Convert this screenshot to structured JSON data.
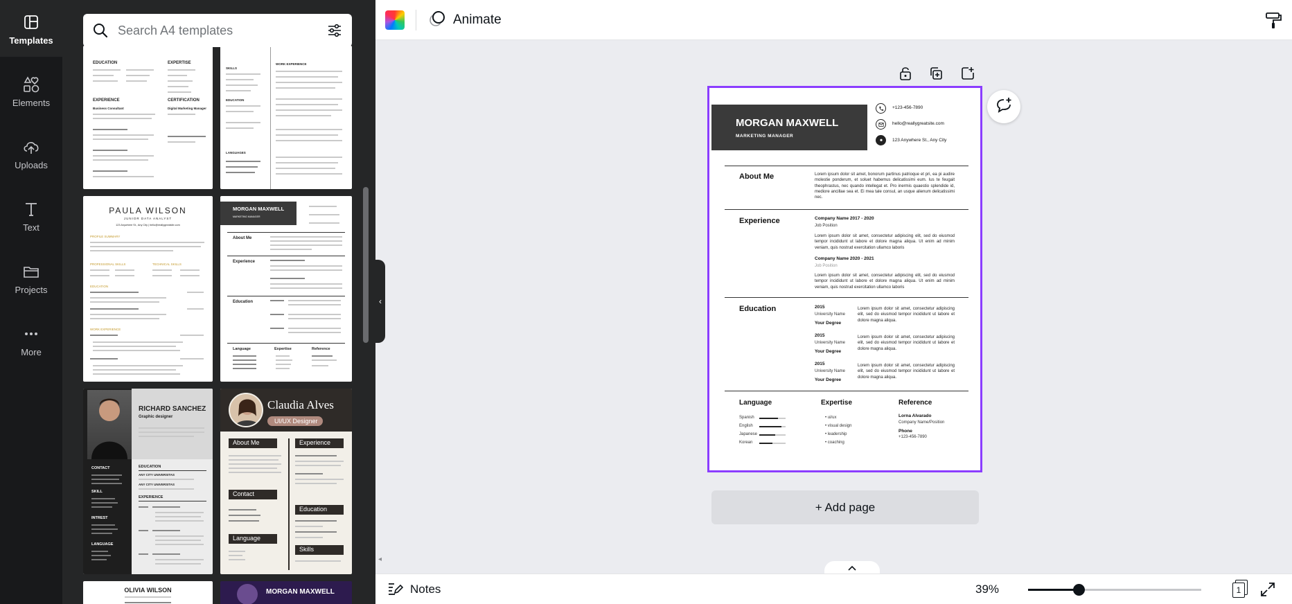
{
  "rail": [
    {
      "label": "Templates",
      "icon": "templates-icon",
      "active": true
    },
    {
      "label": "Elements",
      "icon": "elements-icon"
    },
    {
      "label": "Uploads",
      "icon": "uploads-icon"
    },
    {
      "label": "Text",
      "icon": "text-icon"
    },
    {
      "label": "Projects",
      "icon": "projects-icon"
    },
    {
      "label": "More",
      "icon": "more-icon"
    }
  ],
  "search": {
    "placeholder": "Search A4 templates"
  },
  "thumbnails": {
    "t1": {
      "h1": "EDUCATION",
      "h2": "EXPERTISE",
      "h3": "EXPERIENCE",
      "h4": "CERTIFICATION",
      "r1": "Business Consultant",
      "r2": "Digital Marketing Manager"
    },
    "t2": {
      "h1": "WORK EXPERIENCE",
      "h2": "EDUCATION",
      "h3": "LANGUAGES",
      "h4": "SKILLS"
    },
    "t3": {
      "name": "PAULA WILSON",
      "role": "JUNIOR DATA ANALYST",
      "contact": "123 Anywhere St., Any City | hello@reallygreatsite.com",
      "h1": "PROFILE SUMMARY",
      "h2": "PROFESSIONAL SKILLS",
      "h3": "TECHNICAL SKILLS",
      "h4": "EDUCATION",
      "h5": "WORK EXPERIENCE"
    },
    "t4": {
      "name": "MORGAN MAXWELL",
      "role": "MARKETING MANAGER",
      "s1": "About Me",
      "s2": "Experience",
      "s3": "Education",
      "c1": "Language",
      "c2": "Expertise",
      "c3": "Reference"
    },
    "t5": {
      "name": "RICHARD SANCHEZ",
      "role": "Graphic designer",
      "h1": "CONTACT",
      "h2": "SKILL",
      "h3": "INTREST",
      "h4": "LANGUAGE",
      "h5": "EDUCATION",
      "h6": "EXPERIENCE",
      "u1": "ANY CITY UNIVERSITAS",
      "u2": "ANY CITY UNIVERSITAS"
    },
    "t6": {
      "name": "Claudia Alves",
      "role": "UI/UX Designer",
      "s1": "About Me",
      "s2": "Experience",
      "s3": "Contact",
      "s4": "Education",
      "s5": "Language",
      "s6": "Skills"
    },
    "t7": {
      "name": "OLIVIA WILSON"
    },
    "t8": {
      "name": "MORGAN MAXWELL"
    }
  },
  "toolbar": {
    "animate_label": "Animate"
  },
  "resume": {
    "name": "MORGAN MAXWELL",
    "role": "MARKETING MANAGER",
    "phone": "+123-456-7890",
    "email": "hello@reallygreatsite.com",
    "address": "123 Anywhere St., Any City",
    "about_title": "About Me",
    "about_text": "Lorem ipsum dolor sit amet, bonorum partinus patrioque et pri, ea pi audire molestie ponderum, et soluet habemus delicatissimi eum. Ius te feugait theophrastus, nec quando intellegat et. Pro inermis quaestio splendide id, mediore ancillae sea et. Ei mea tale consul, an usque alienum delicatissimi nec.",
    "exp_title": "Experience",
    "exp1_company": "Company Name 2017 - 2020",
    "exp1_position": "Job Position",
    "exp1_text": "Lorem ipsum dolor sit amet, consectetur adipiscing elit, sed do eiusmod tempor incididunt ut labore et dolore magna aliqua. Ut enim ad minim veniam, quis nostrud exercitation ullamco laboris",
    "exp2_company": "Company Name 2020 - 2021",
    "exp2_position": "Job Position",
    "exp2_text": "Lorem ipsum dolor sit amet, consectetur adipiscing elit, sed do eiusmod tempor incididunt ut labore et dolore magna aliqua. Ut enim ad minim veniam, quis nostrud exercitation ullamco laboris",
    "edu_title": "Education",
    "edu": [
      {
        "year": "2015",
        "uni": "University Name",
        "degree": "Your Degree",
        "text": "Lorem ipsum dolor sit amet, consectetur adipiscing elit, sed do eiusmod tempor incididunt ut labore et dolore magna aliqua."
      },
      {
        "year": "2015",
        "uni": "University Name",
        "degree": "Your Degree",
        "text": "Lorem ipsum dolor sit amet, consectetur adipiscing elit, sed do eiusmod tempor incididunt ut labore et dolore magna aliqua."
      },
      {
        "year": "2015",
        "uni": "University Name",
        "degree": "Your Degree",
        "text": "Lorem ipsum dolor sit amet, consectetur adipiscing elit, sed do eiusmod tempor incididunt ut labore et dolore magna aliqua."
      }
    ],
    "lang_title": "Language",
    "languages": [
      {
        "name": "Spanish",
        "level": 0.7
      },
      {
        "name": "English",
        "level": 0.85
      },
      {
        "name": "Japanese",
        "level": 0.6
      },
      {
        "name": "Korean",
        "level": 0.5
      }
    ],
    "expertise_title": "Expertise",
    "expertise": [
      "ui/ux",
      "visual design",
      "leadership",
      "coaching"
    ],
    "ref_title": "Reference",
    "ref_name": "Lorna Alvarado",
    "ref_company": "Company Name/Position",
    "ref_phone_label": "Phone",
    "ref_phone": "+123-456-7890"
  },
  "canvas": {
    "add_page_label": "+ Add page"
  },
  "bottombar": {
    "notes_label": "Notes",
    "zoom": "39%",
    "zoom_fraction": 0.39,
    "page_number": "1"
  },
  "colors": {
    "accent": "#8b3dff",
    "panel": "#252627",
    "rail": "#18191b"
  }
}
